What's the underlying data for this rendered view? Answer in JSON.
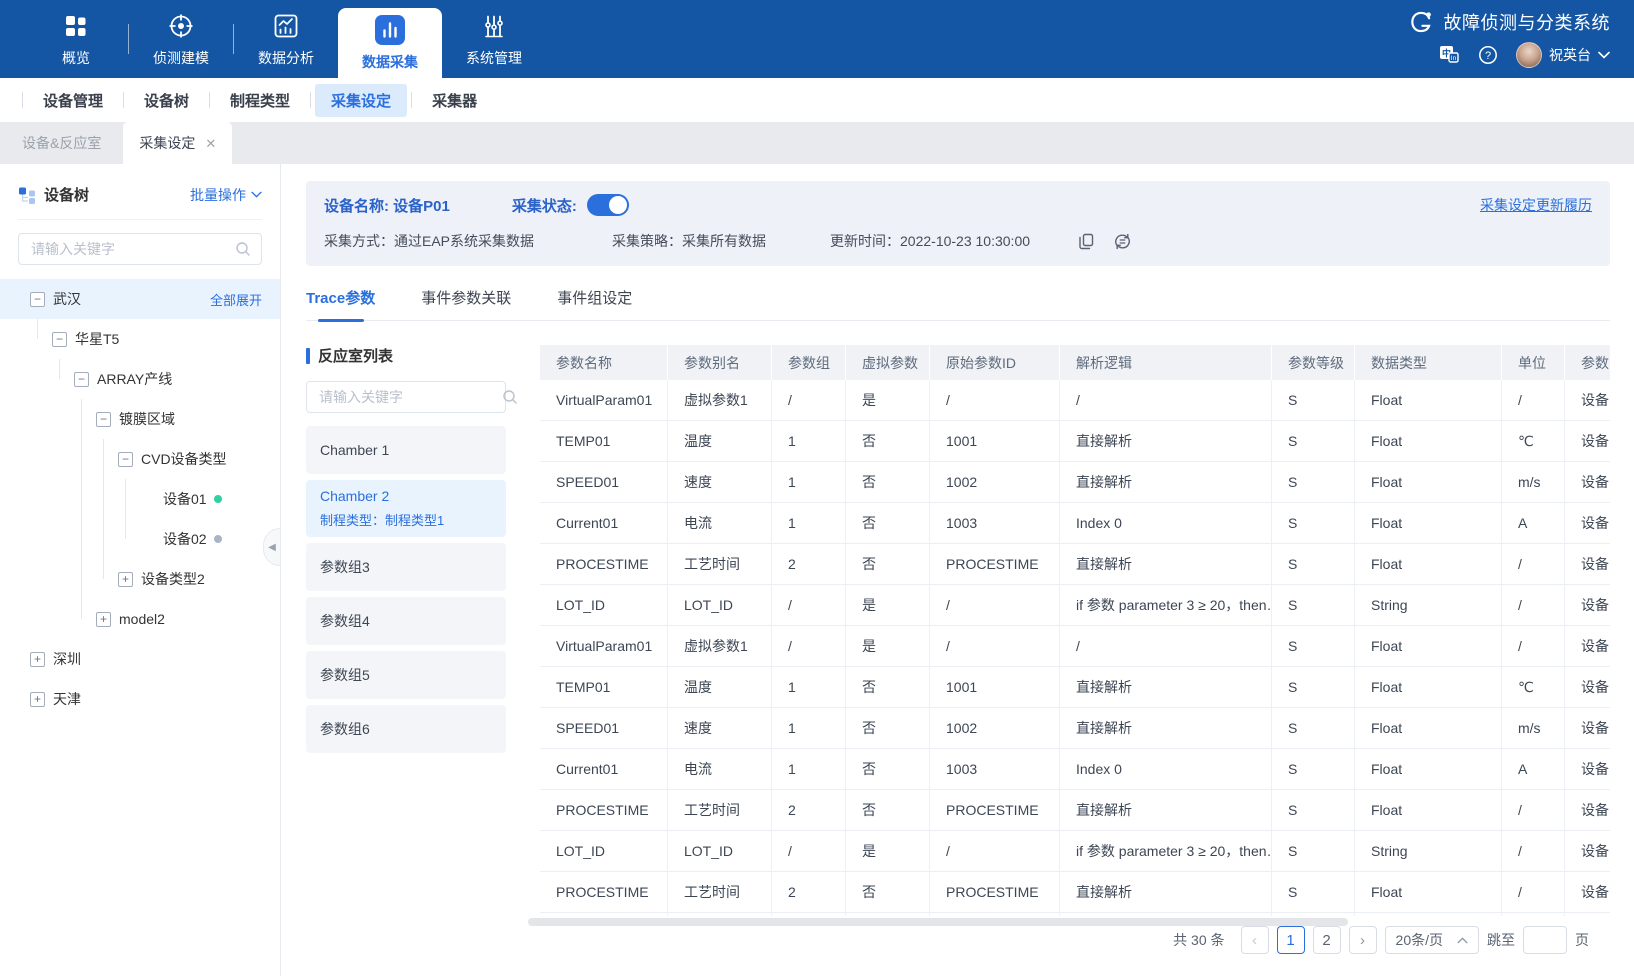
{
  "app": {
    "title": "故障侦测与分类系统",
    "user_name": "祝英台"
  },
  "top_nav": {
    "items": [
      {
        "label": "概览",
        "icon": "grid-icon",
        "active": false
      },
      {
        "label": "侦测建模",
        "icon": "radar-icon",
        "active": false
      },
      {
        "label": "数据分析",
        "icon": "analysis-chart-icon",
        "active": false
      },
      {
        "label": "数据采集",
        "icon": "bar-chart-icon",
        "active": true
      },
      {
        "label": "系统管理",
        "icon": "sliders-icon",
        "active": false
      }
    ]
  },
  "sub_nav": {
    "items": [
      {
        "label": "设备管理",
        "active": false
      },
      {
        "label": "设备树",
        "active": false
      },
      {
        "label": "制程类型",
        "active": false
      },
      {
        "label": "采集设定",
        "active": true
      },
      {
        "label": "采集器",
        "active": false
      }
    ]
  },
  "tab_strip": {
    "tabs": [
      {
        "label": "设备&反应室",
        "active": false,
        "closable": false
      },
      {
        "label": "采集设定",
        "active": true,
        "closable": true
      }
    ]
  },
  "sidebar": {
    "title": "设备树",
    "batch_action_label": "批量操作",
    "search_placeholder": "请输入关键字",
    "tree": [
      {
        "label": "武汉",
        "state": "expanded",
        "level": 0,
        "selected": true,
        "action": "全部展开"
      },
      {
        "label": "华星T5",
        "state": "expanded",
        "level": 1
      },
      {
        "label": "ARRAY产线",
        "state": "expanded",
        "level": 2
      },
      {
        "label": "镀膜区域",
        "state": "expanded",
        "level": 3
      },
      {
        "label": "CVD设备类型",
        "state": "expanded",
        "level": 4
      },
      {
        "label": "设备01",
        "state": "leaf",
        "level": 5,
        "status_color": "#2fd0a2"
      },
      {
        "label": "设备02",
        "state": "leaf",
        "level": 5,
        "status_color": "#a9b5c5"
      },
      {
        "label": "设备类型2",
        "state": "collapsed",
        "level": 4
      },
      {
        "label": "model2",
        "state": "collapsed",
        "level": 3
      },
      {
        "label": "深圳",
        "state": "collapsed",
        "level": 0
      },
      {
        "label": "天津",
        "state": "collapsed",
        "level": 0
      }
    ]
  },
  "device_panel": {
    "name_label": "设备名称: 设备P01",
    "status_label": "采集状态:",
    "toggle_on": true,
    "history_link": "采集设定更新履历",
    "method": "采集方式：通过EAP系统采集数据",
    "strategy": "采集策略：采集所有数据",
    "updated": "更新时间：2022-10-23 10:30:00"
  },
  "content_tabs": [
    {
      "label": "Trace参数",
      "active": true
    },
    {
      "label": "事件参数关联",
      "active": false
    },
    {
      "label": "事件组设定",
      "active": false
    }
  ],
  "chamber_panel": {
    "title": "反应室列表",
    "search_placeholder": "请输入关键字",
    "items": [
      {
        "title": "Chamber 1",
        "subtitle": "",
        "active": false
      },
      {
        "title": "Chamber 2",
        "subtitle": "制程类型：制程类型1",
        "active": true
      },
      {
        "title": "参数组3",
        "subtitle": "",
        "active": false
      },
      {
        "title": "参数组4",
        "subtitle": "",
        "active": false
      },
      {
        "title": "参数组5",
        "subtitle": "",
        "active": false
      },
      {
        "title": "参数组6",
        "subtitle": "",
        "active": false
      }
    ]
  },
  "table": {
    "columns": [
      "参数名称",
      "参数别名",
      "参数组",
      "虚拟参数",
      "原始参数ID",
      "解析逻辑",
      "参数等级",
      "数据类型",
      "单位",
      "参数"
    ],
    "rows": [
      [
        "VirtualParam01",
        "虚拟参数1",
        "/",
        "是",
        "/",
        "/",
        "S",
        "Float",
        "/",
        "设备"
      ],
      [
        "TEMP01",
        "温度",
        "1",
        "否",
        "1001",
        "直接解析",
        "S",
        "Float",
        "℃",
        "设备"
      ],
      [
        "SPEED01",
        "速度",
        "1",
        "否",
        "1002",
        "直接解析",
        "S",
        "Float",
        "m/s",
        "设备"
      ],
      [
        "Current01",
        "电流",
        "1",
        "否",
        "1003",
        "Index 0",
        "S",
        "Float",
        "A",
        "设备"
      ],
      [
        "PROCESTIME",
        "工艺时间",
        "2",
        "否",
        "PROCESTIME",
        "直接解析",
        "S",
        "Float",
        "/",
        "设备"
      ],
      [
        "LOT_ID",
        "LOT_ID",
        "/",
        "是",
        "/",
        "if 参数 parameter 3 ≥ 20，then…",
        "S",
        "String",
        "/",
        "设备"
      ],
      [
        "VirtualParam01",
        "虚拟参数1",
        "/",
        "是",
        "/",
        "/",
        "S",
        "Float",
        "/",
        "设备"
      ],
      [
        "TEMP01",
        "温度",
        "1",
        "否",
        "1001",
        "直接解析",
        "S",
        "Float",
        "℃",
        "设备"
      ],
      [
        "SPEED01",
        "速度",
        "1",
        "否",
        "1002",
        "直接解析",
        "S",
        "Float",
        "m/s",
        "设备"
      ],
      [
        "Current01",
        "电流",
        "1",
        "否",
        "1003",
        "Index 0",
        "S",
        "Float",
        "A",
        "设备"
      ],
      [
        "PROCESTIME",
        "工艺时间",
        "2",
        "否",
        "PROCESTIME",
        "直接解析",
        "S",
        "Float",
        "/",
        "设备"
      ],
      [
        "LOT_ID",
        "LOT_ID",
        "/",
        "是",
        "/",
        "if 参数 parameter 3 ≥ 20，then…",
        "S",
        "String",
        "/",
        "设备"
      ],
      [
        "PROCESTIME",
        "工艺时间",
        "2",
        "否",
        "PROCESTIME",
        "直接解析",
        "S",
        "Float",
        "/",
        "设备"
      ],
      [
        "",
        "",
        "",
        "",
        "",
        "",
        "",
        "",
        "",
        ""
      ]
    ]
  },
  "pagination": {
    "total": "共 30 条",
    "pages": [
      "1",
      "2"
    ],
    "current": "1",
    "page_size": "20条/页",
    "jump_label": "跳至",
    "jump_suffix": "页",
    "jump_value": ""
  },
  "colors": {
    "accent": "#2b6fdd",
    "nav_bg": "#1456a3",
    "highlight": "#e8f3fe",
    "online_dot": "#2fd0a2",
    "offline_dot": "#a9b5c5"
  }
}
